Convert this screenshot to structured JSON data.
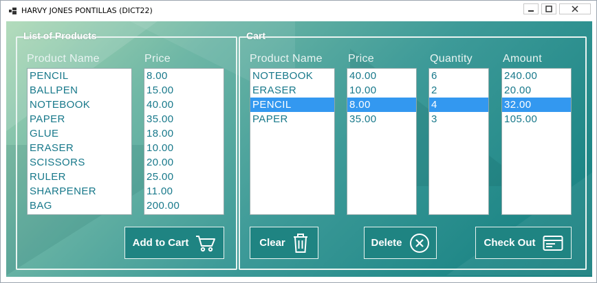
{
  "window": {
    "title": "HARVY JONES PONTILLAS (DICT22)"
  },
  "products": {
    "group_label": "List of Products",
    "headers": {
      "name": "Product Name",
      "price": "Price"
    },
    "items": [
      {
        "name": "PENCIL",
        "price": "8.00"
      },
      {
        "name": "BALLPEN",
        "price": "15.00"
      },
      {
        "name": "NOTEBOOK",
        "price": "40.00"
      },
      {
        "name": "PAPER",
        "price": "35.00"
      },
      {
        "name": "GLUE",
        "price": "18.00"
      },
      {
        "name": "ERASER",
        "price": "10.00"
      },
      {
        "name": "SCISSORS",
        "price": "20.00"
      },
      {
        "name": "RULER",
        "price": "25.00"
      },
      {
        "name": "SHARPENER",
        "price": "11.00"
      },
      {
        "name": "BAG",
        "price": "200.00"
      }
    ],
    "add_button": "Add to Cart"
  },
  "cart": {
    "group_label": "Cart",
    "headers": {
      "name": "Product Name",
      "price": "Price",
      "quantity": "Quantity",
      "amount": "Amount"
    },
    "items": [
      {
        "name": "NOTEBOOK",
        "price": "40.00",
        "quantity": "6",
        "amount": "240.00",
        "selected": false
      },
      {
        "name": "ERASER",
        "price": "10.00",
        "quantity": "2",
        "amount": "20.00",
        "selected": false
      },
      {
        "name": "PENCIL",
        "price": "8.00",
        "quantity": "4",
        "amount": "32.00",
        "selected": true
      },
      {
        "name": "PAPER",
        "price": "35.00",
        "quantity": "3",
        "amount": "105.00",
        "selected": false
      }
    ],
    "buttons": {
      "clear": "Clear",
      "delete": "Delete",
      "checkout": "Check Out"
    }
  },
  "icons": {
    "cart": "shopping-cart-icon",
    "trash": "trash-icon",
    "delete": "circle-x-icon",
    "checkout": "credit-card-icon"
  },
  "colors": {
    "list_text": "#17788a",
    "selection": "#3398f0",
    "button_bg": "#1f8482"
  }
}
